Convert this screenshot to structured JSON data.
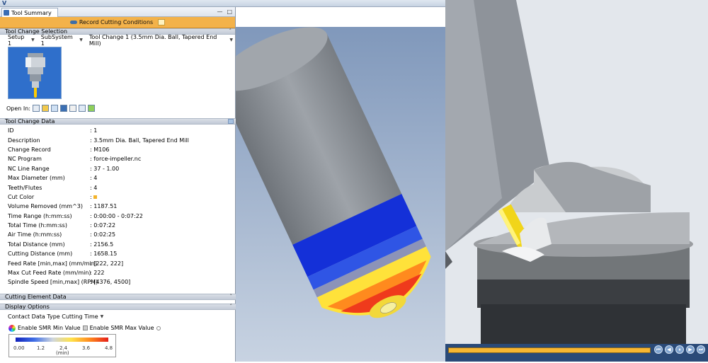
{
  "window": {
    "logo": "V",
    "collapse_glyph": "˅"
  },
  "tab": {
    "label": "Tool Summary",
    "ctl_min": "—",
    "ctl_close": "□"
  },
  "record_button": {
    "label": "Record Cutting Conditions"
  },
  "tool_change_selection": {
    "header": "Tool Change Selection",
    "setup": "Setup 1",
    "subsystem": "SubSystem 1",
    "tool_change": "Tool Change 1 (3.5mm Dia. Ball, Tapered End Mill)",
    "open_in_label": "Open In:",
    "open_icons": [
      "tool-manager-icon",
      "setup-icon",
      "graph-icon",
      "grid-icon",
      "optipath-icon",
      "report-icon",
      "refresh-icon"
    ]
  },
  "tool_change_data": {
    "header": "Tool Change Data",
    "rows": [
      {
        "label": "ID",
        "value": ": 1"
      },
      {
        "label": "Description",
        "value": ": 3.5mm Dia. Ball, Tapered End Mill"
      },
      {
        "label": "Change Record",
        "value": ": M106"
      },
      {
        "label": "NC Program",
        "value": ": force-impeller.nc"
      },
      {
        "label": "NC Line Range",
        "value": ": 37 - 1.00"
      },
      {
        "label": "Max Diameter (mm)",
        "value": ": 4"
      },
      {
        "label": "Teeth/Flutes",
        "value": ": 4"
      },
      {
        "label": "Cut Color",
        "value": ":"
      },
      {
        "label": "Volume Removed (mm^3)",
        "value": ": 1187.51"
      },
      {
        "label": "Time Range (h:mm:ss)",
        "value": ": 0:00:00 - 0:07:22"
      },
      {
        "label": "Total Time (h:mm:ss)",
        "value": ": 0:07:22"
      },
      {
        "label": "Air Time (h:mm:ss)",
        "value": ": 0:02:25"
      },
      {
        "label": "Total Distance (mm)",
        "value": ": 2156.5"
      },
      {
        "label": "Cutting Distance (mm)",
        "value": ": 1658.15"
      },
      {
        "label": "Feed Rate [min,max] (mm/min)",
        "value": ": [222, 222]"
      },
      {
        "label": "Max Cut Feed Rate (mm/min)",
        "value": ": 222"
      },
      {
        "label": "Spindle Speed [min,max] (RPM)",
        "value": ": [4376, 4500]"
      }
    ],
    "cut_color": "#f3b32a"
  },
  "cutting_element_data": {
    "header": "Cutting Element Data"
  },
  "display_options": {
    "header": "Display Options",
    "contact_type": "Contact Data Type Cutting Time",
    "enable_min": "Enable SMR Min Value",
    "enable_max": "Enable SMR Max Value",
    "legend": {
      "ticks": [
        "0.00",
        "1.2",
        "2.4",
        "3.6",
        "4.8"
      ],
      "unit": "(min)"
    }
  },
  "playback": {
    "buttons": [
      "⏮",
      "◀",
      "⏸",
      "▶",
      "⏭"
    ]
  }
}
